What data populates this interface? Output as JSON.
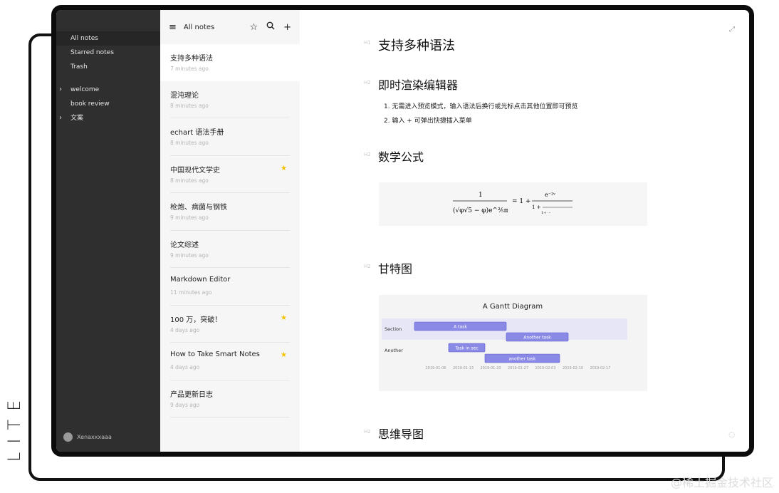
{
  "sidebar": {
    "nav": [
      {
        "label": "All notes"
      },
      {
        "label": "Starred notes"
      },
      {
        "label": "Trash"
      }
    ],
    "folders": [
      {
        "label": "welcome",
        "expandable": true
      },
      {
        "label": "book review",
        "expandable": false
      },
      {
        "label": "文案",
        "expandable": true
      }
    ],
    "user": {
      "name": "Xenaxxxaaa"
    }
  },
  "list": {
    "header_title": "All notes",
    "notes": [
      {
        "title": "支持多种语法",
        "time": "7 minutes ago",
        "starred": false,
        "selected": true
      },
      {
        "title": "混沌理论",
        "time": "8 minutes ago",
        "starred": false
      },
      {
        "title": "echart 语法手册",
        "time": "8 minutes ago",
        "starred": false
      },
      {
        "title": "中国现代文学史",
        "time": "8 minutes ago",
        "starred": true
      },
      {
        "title": "枪炮、病菌与钢铁",
        "time": "9 minutes ago",
        "starred": false
      },
      {
        "title": "论文综述",
        "time": "9 minutes ago",
        "starred": false
      },
      {
        "title": "Markdown Editor",
        "time": "11 minutes ago",
        "starred": false
      },
      {
        "title": "100 万，突破！",
        "time": "4 days ago",
        "starred": true
      },
      {
        "title": "How to Take Smart Notes",
        "time": "4 days ago",
        "starred": true
      },
      {
        "title": "产品更新日志",
        "time": "9 days ago",
        "starred": false
      }
    ]
  },
  "editor": {
    "h1": {
      "tag": "H1",
      "text": "支持多种语法"
    },
    "sections": [
      {
        "tag": "H2",
        "text": "即时渲染编辑器"
      },
      {
        "tag": "H2",
        "text": "数学公式"
      },
      {
        "tag": "H2",
        "text": "甘特图"
      },
      {
        "tag": "H2",
        "text": "思维导图"
      }
    ],
    "list_items": [
      "1. 无需进入预览模式，输入语法后换行或光标点击其他位置即可预览",
      "2. 输入 + 可弹出快捷插入菜单"
    ],
    "math": {
      "numerator": "1",
      "rhs": "= 1 +",
      "exp": "e⁻²ᵛ"
    },
    "gantt": {
      "title": "A Gantt Diagram",
      "sections": [
        "Section",
        "Another"
      ],
      "tasks": [
        {
          "name": "A task",
          "section": "Section",
          "start": 0.0,
          "end": 0.43
        },
        {
          "name": "Another task",
          "section": "Section",
          "start": 0.43,
          "end": 0.72
        },
        {
          "name": "Task in sec",
          "section": "Another",
          "start": 0.16,
          "end": 0.33
        },
        {
          "name": "another task",
          "section": "Another",
          "start": 0.33,
          "end": 0.68
        }
      ],
      "ticks": [
        "2019-01-06",
        "2019-01-13",
        "2019-01-20",
        "2019-01-27",
        "2019-02-03",
        "2019-02-10",
        "2019-02-17"
      ]
    }
  },
  "branding": {
    "side_label": "LITE",
    "watermark": "@稀土掘金技术社区"
  },
  "colors": {
    "sidebar": "#2f2f2f",
    "star": "#f2c300",
    "gantt_bar": "#8a8ae6"
  }
}
